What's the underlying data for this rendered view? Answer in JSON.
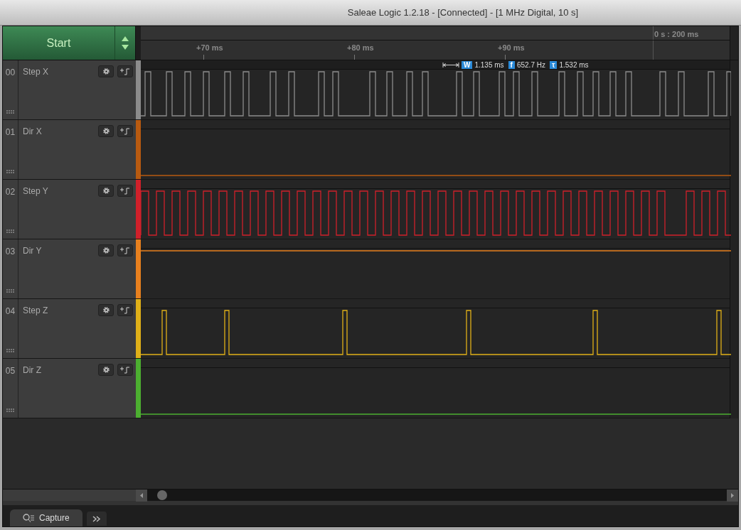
{
  "window": {
    "title": "Saleae Logic 1.2.18 - [Connected] - [1 MHz Digital, 10 s]"
  },
  "start_button": {
    "label": "Start"
  },
  "timeline": {
    "origin": "0 s : 200 ms",
    "ticks": [
      "+70 ms",
      "+80 ms",
      "+90 ms"
    ]
  },
  "measurement": {
    "width": "1.135 ms",
    "frequency": "652.7 Hz",
    "period": "1.532 ms",
    "width_tag": "W",
    "frequency_tag": "f",
    "period_tag": "τ"
  },
  "channels": [
    {
      "number": "00",
      "name": "Step X",
      "color": "#8c8c8c",
      "kind": "irregular"
    },
    {
      "number": "01",
      "name": "Dir X",
      "color": "#b85a10",
      "kind": "low"
    },
    {
      "number": "02",
      "name": "Step Y",
      "color": "#d0202a",
      "kind": "clock"
    },
    {
      "number": "03",
      "name": "Dir Y",
      "color": "#e8801e",
      "kind": "high"
    },
    {
      "number": "04",
      "name": "Step Z",
      "color": "#e0b018",
      "kind": "sparse"
    },
    {
      "number": "05",
      "name": "Dir Z",
      "color": "#4caf30",
      "kind": "low"
    }
  ],
  "tabs": [
    {
      "label": "Capture",
      "selected": true
    }
  ]
}
